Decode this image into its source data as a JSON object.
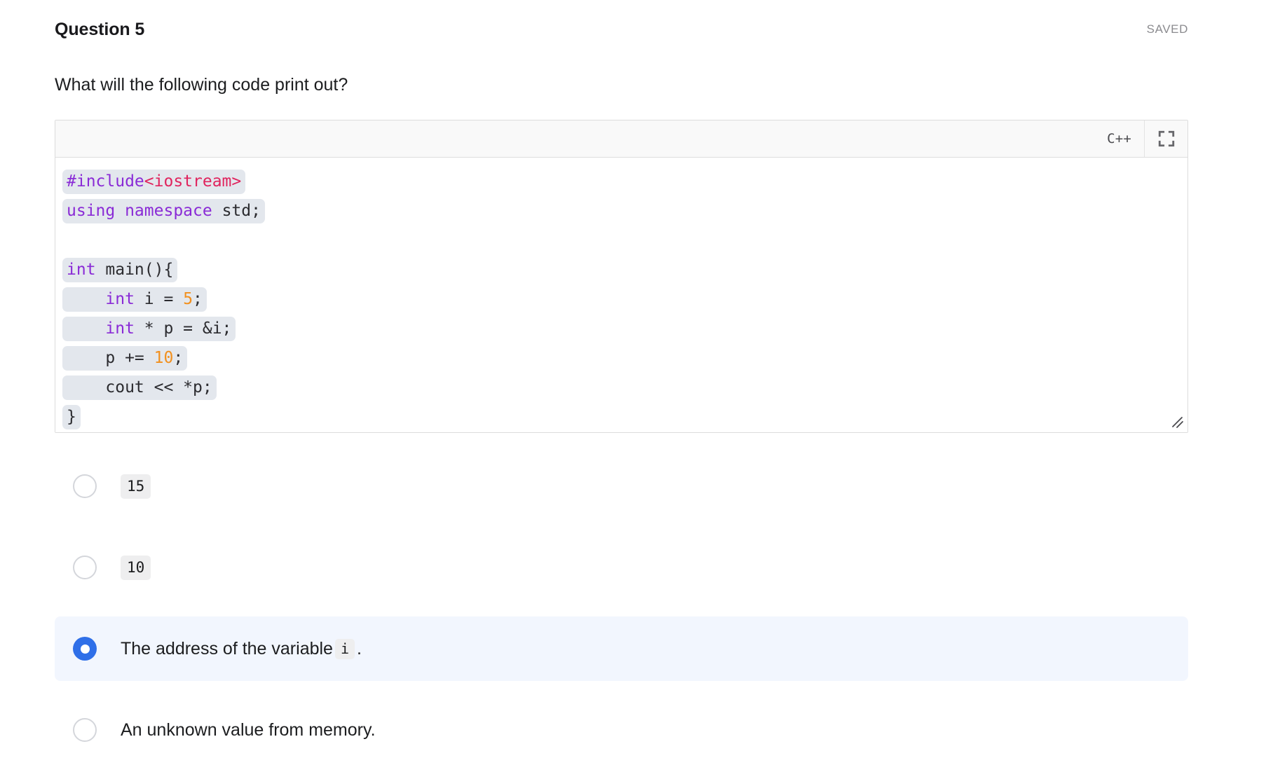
{
  "header": {
    "title": "Question 5",
    "status": "SAVED"
  },
  "prompt": "What will the following code print out?",
  "editor": {
    "language": "C++",
    "expand_icon": "expand-fullscreen-icon",
    "resize_icon": "resize-grip-icon",
    "code_lines": [
      [
        {
          "t": "#include",
          "c": "k-pre"
        },
        {
          "t": "<iostream>",
          "c": "k-inc"
        }
      ],
      [
        {
          "t": "using namespace ",
          "c": "k-kw"
        },
        {
          "t": "std;",
          "c": "k-txt"
        }
      ],
      [],
      [
        {
          "t": "int",
          "c": "k-kw"
        },
        {
          "t": " main(){",
          "c": "k-txt"
        }
      ],
      [
        {
          "t": "    ",
          "c": "k-txt"
        },
        {
          "t": "int",
          "c": "k-kw"
        },
        {
          "t": " i = ",
          "c": "k-txt"
        },
        {
          "t": "5",
          "c": "k-num"
        },
        {
          "t": ";",
          "c": "k-txt"
        }
      ],
      [
        {
          "t": "    ",
          "c": "k-txt"
        },
        {
          "t": "int",
          "c": "k-kw"
        },
        {
          "t": " * p = &i;",
          "c": "k-txt"
        }
      ],
      [
        {
          "t": "    p += ",
          "c": "k-txt"
        },
        {
          "t": "10",
          "c": "k-num"
        },
        {
          "t": ";",
          "c": "k-txt"
        }
      ],
      [
        {
          "t": "    cout << *p;",
          "c": "k-txt"
        }
      ],
      [
        {
          "t": "}",
          "c": "k-txt"
        }
      ]
    ]
  },
  "options": [
    {
      "id": "option-15",
      "kind": "code",
      "text": "15",
      "selected": false
    },
    {
      "id": "option-10",
      "kind": "code",
      "text": "10",
      "selected": false
    },
    {
      "id": "option-address-of-i",
      "kind": "mixed",
      "text_before": "The address of the variable",
      "chip": "i",
      "text_after": ".",
      "selected": true
    },
    {
      "id": "option-unknown-value",
      "kind": "text",
      "text": "An unknown value from memory.",
      "selected": false
    }
  ],
  "colors": {
    "accent": "#2f6fe8",
    "selected_row_bg": "#f2f6fe",
    "code_highlight": "#e3e7ed",
    "keyword": "#8a2bd6",
    "include_path": "#e0245e",
    "number": "#f2901e",
    "muted_text": "#8b8b8f"
  }
}
